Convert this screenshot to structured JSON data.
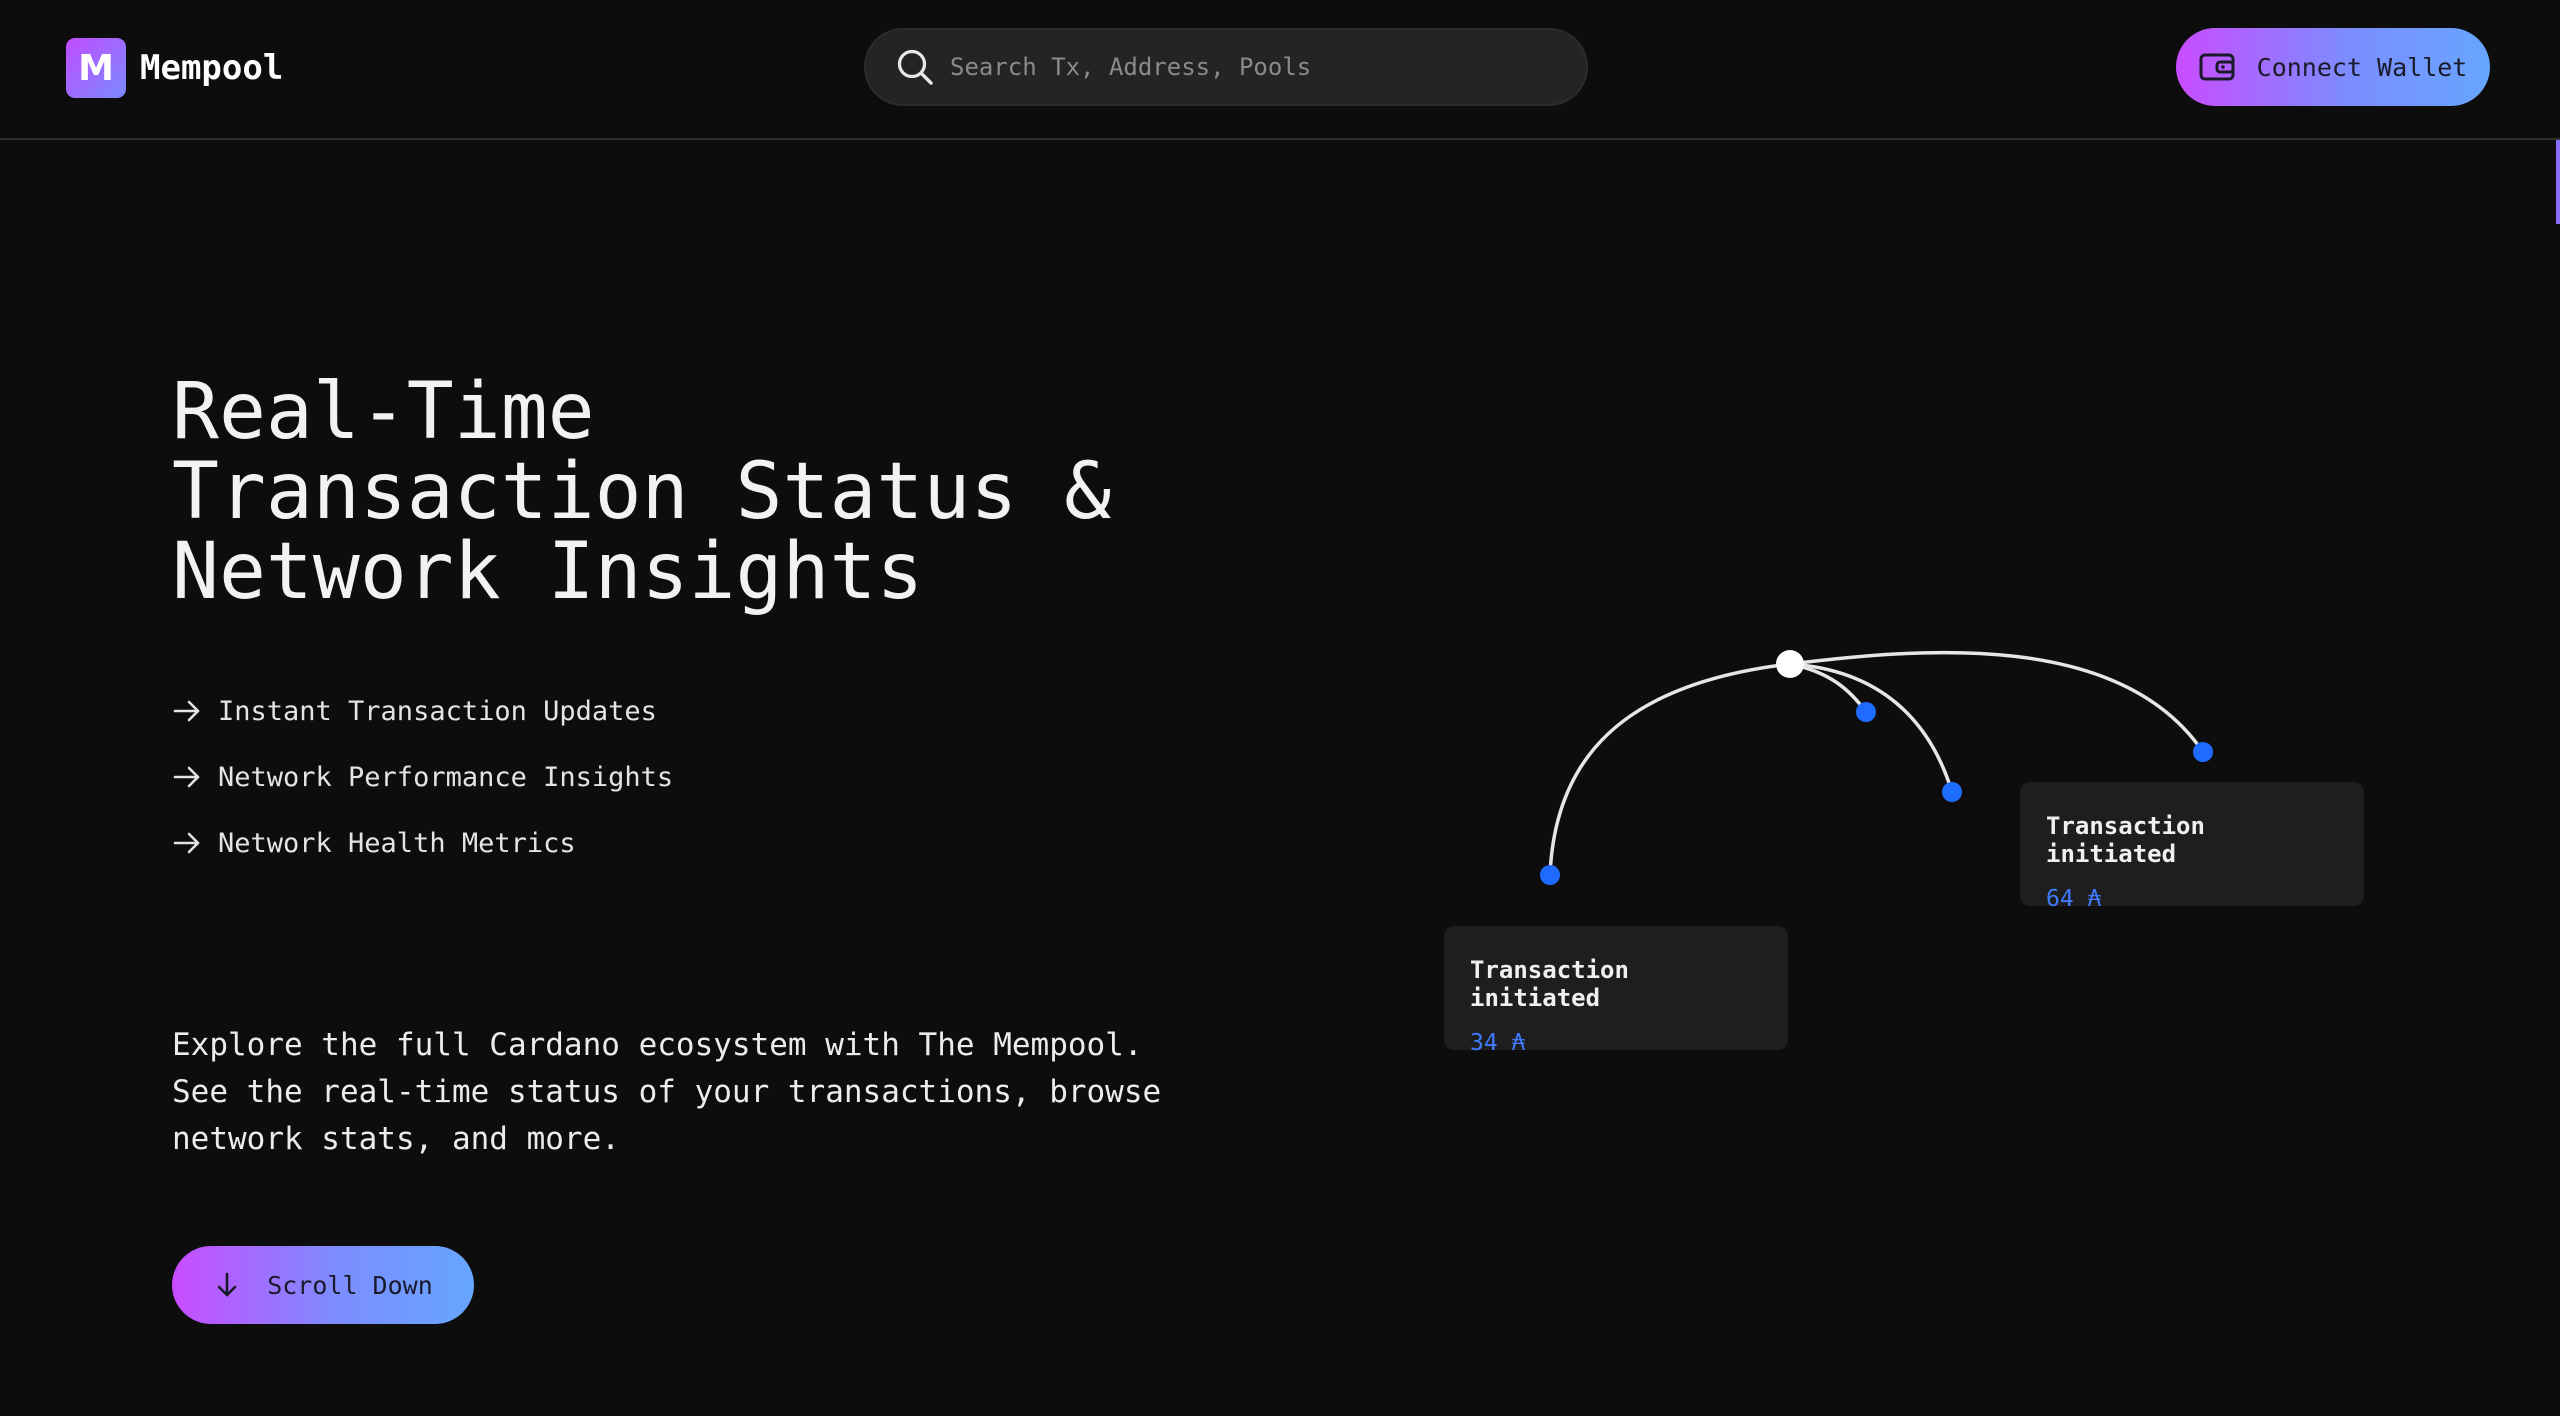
{
  "header": {
    "logo_letter": "M",
    "app_name": "Mempool",
    "search_placeholder": "Search Tx, Address, Pools",
    "connect_wallet_label": "Connect Wallet"
  },
  "hero": {
    "title_lines": [
      "Real-Time",
      "Transaction Status &",
      "Network Insights"
    ],
    "features": [
      "Instant Transaction Updates",
      "Network Performance Insights",
      "Network Health Metrics"
    ],
    "description": "Explore the full Cardano ecosystem with The Mempool. See the real-time status of your transactions, browse network stats, and more.",
    "scroll_label": "Scroll Down"
  },
  "diagram": {
    "cards": [
      {
        "title": "Transaction initiated",
        "amount": "34 ₳"
      },
      {
        "title": "Transaction initiated",
        "amount": "64 ₳"
      }
    ],
    "colors": {
      "node": "#1f6bff",
      "hub": "#ffffff",
      "line": "#e6e6e6"
    }
  },
  "colors": {
    "background": "#0d0d0d",
    "accent_gradient_start": "#c94cff",
    "accent_gradient_end": "#66a6ff",
    "amount": "#3f7bff"
  }
}
